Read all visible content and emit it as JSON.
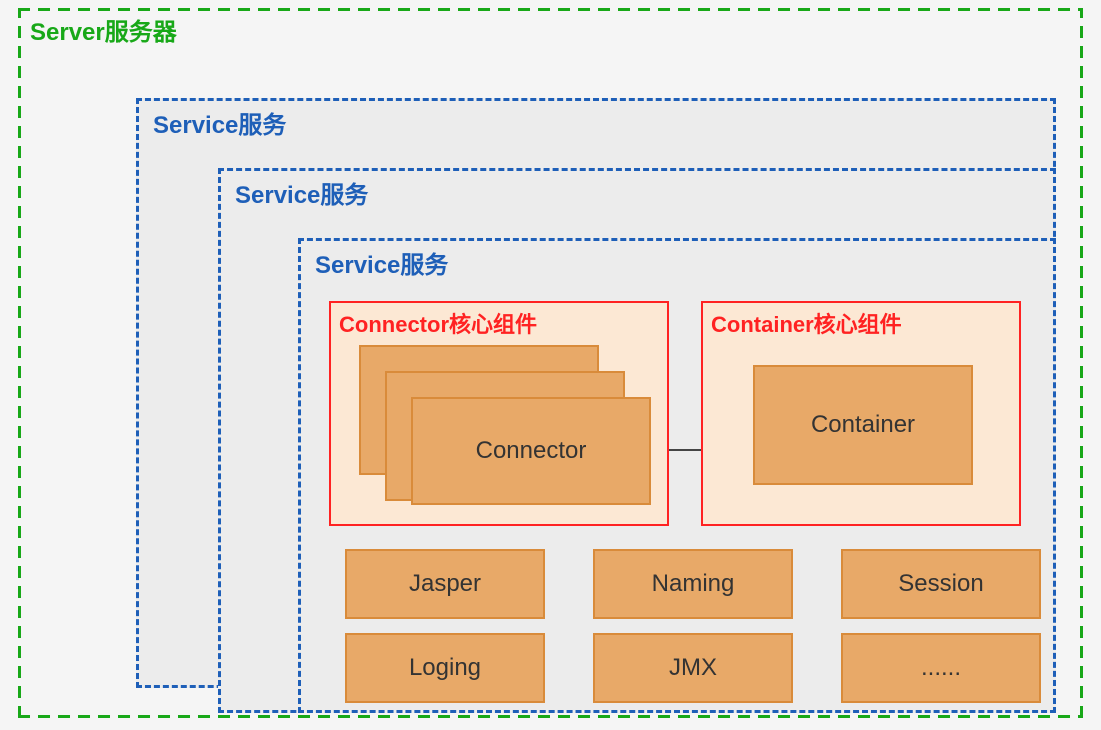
{
  "server": {
    "label": "Server服务器"
  },
  "service": {
    "label_1": "Service服务",
    "label_2": "Service服务",
    "label_3": "Service服务"
  },
  "connector_core": {
    "title": "Connector核心组件",
    "box_label": "Connector"
  },
  "container_core": {
    "title": "Container核心组件",
    "box_label": "Container"
  },
  "modules": {
    "jasper": "Jasper",
    "naming": "Naming",
    "session": "Session",
    "loging": "Loging",
    "jmx": "JMX",
    "more": "......"
  }
}
